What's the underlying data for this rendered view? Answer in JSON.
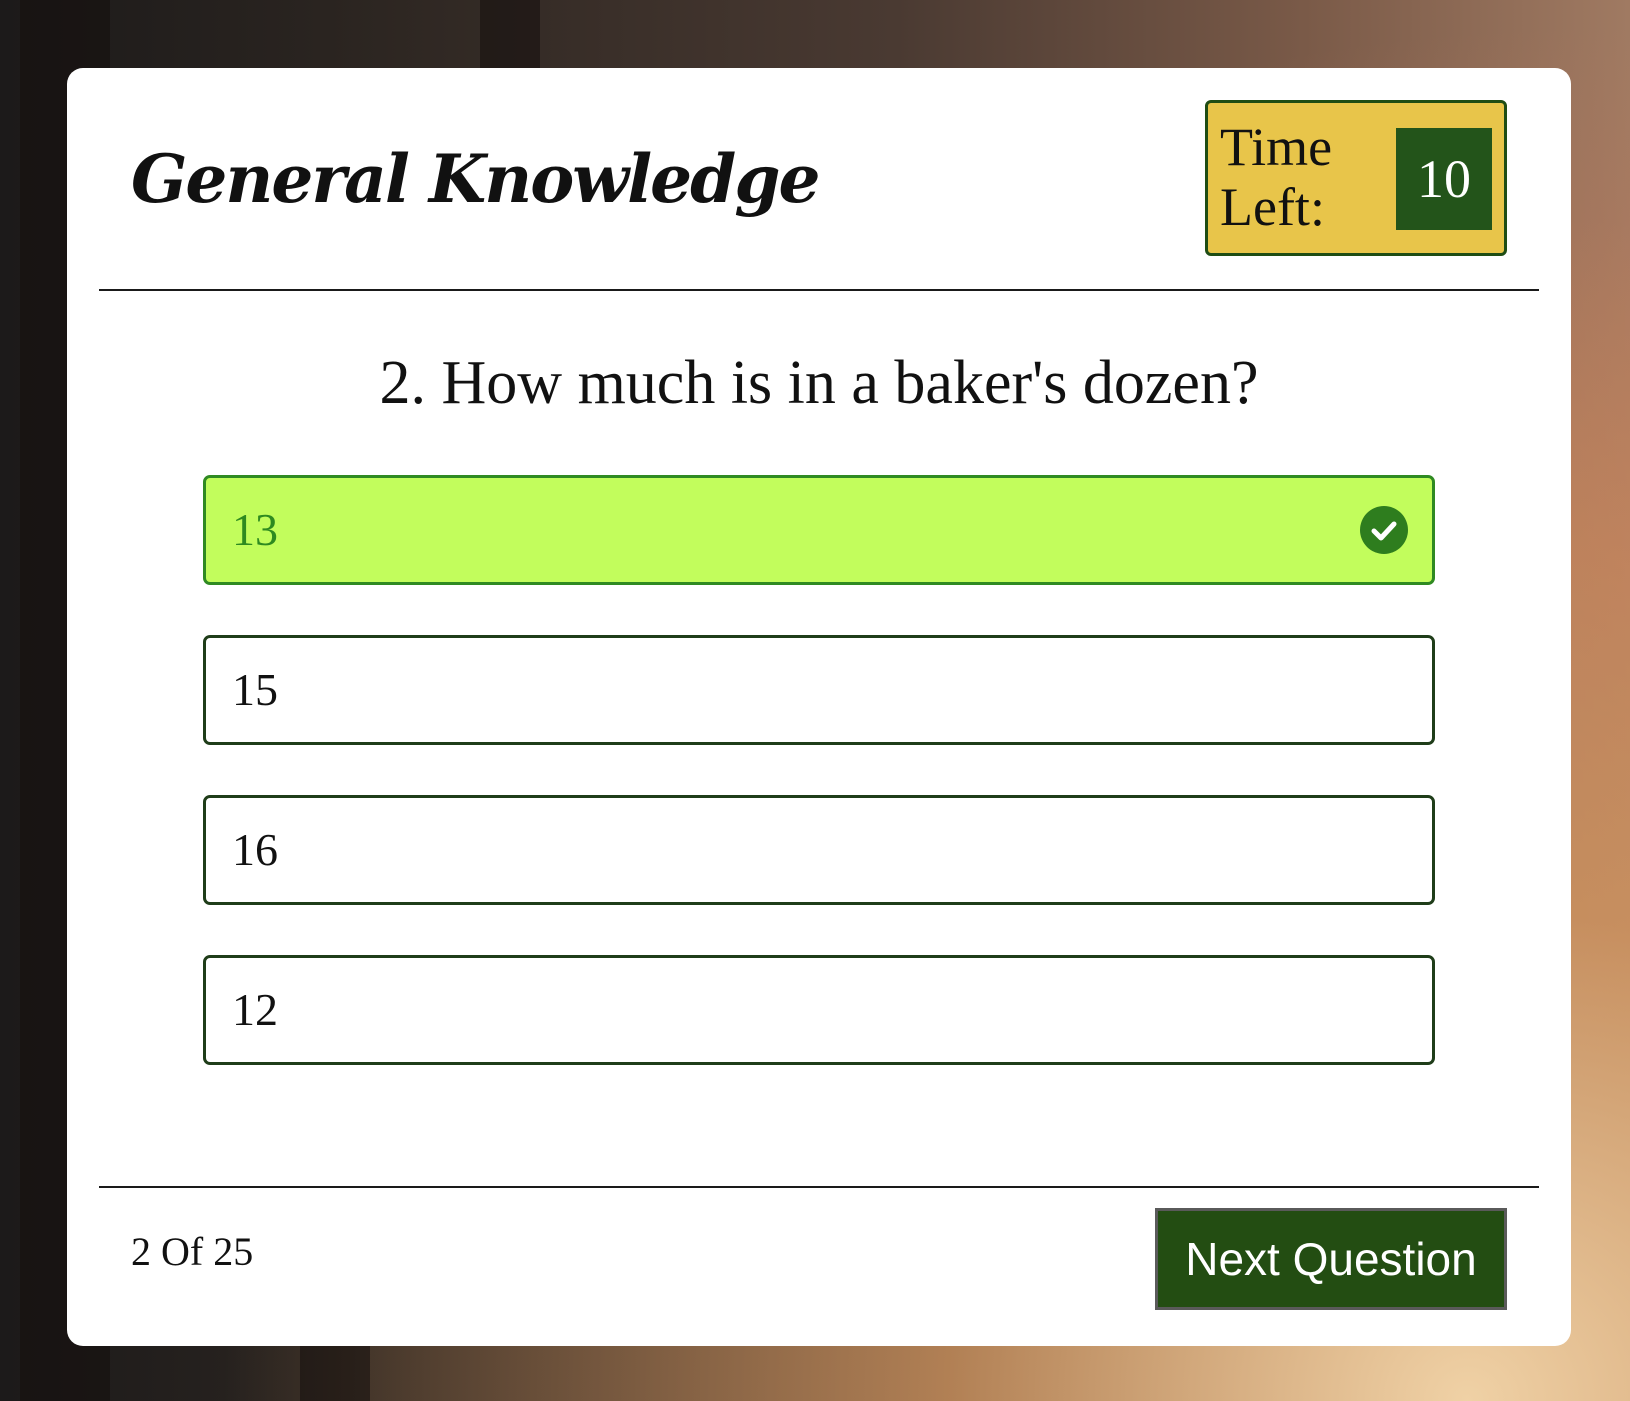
{
  "quiz": {
    "title": "General Knowledge",
    "timer": {
      "label": "Time Left:",
      "value": "10"
    },
    "question": "2. How much is in a baker's dozen?",
    "options": [
      {
        "label": "13",
        "state": "correct",
        "icon": "check-circle-icon"
      },
      {
        "label": "15",
        "state": "default"
      },
      {
        "label": "16",
        "state": "default"
      },
      {
        "label": "12",
        "state": "default"
      }
    ],
    "progress": "2 Of 25",
    "next_label": "Next Question"
  },
  "colors": {
    "correct_fill": "#c2fd5c",
    "correct_border": "#2f8a22",
    "accent_green": "#234d12",
    "timer_yellow": "#e8c54a"
  }
}
